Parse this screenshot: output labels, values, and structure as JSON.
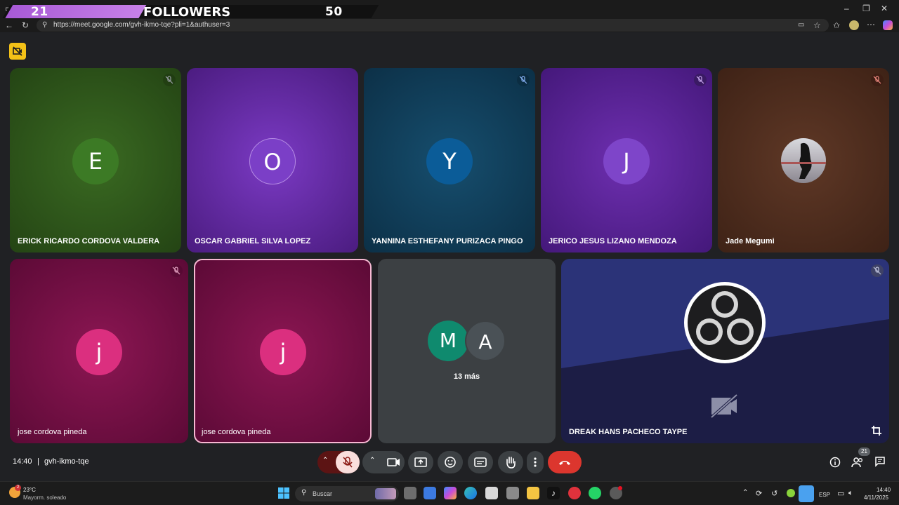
{
  "overlay": {
    "left_count": "21",
    "label": "FOLLOWERS",
    "right_count": "50"
  },
  "browser": {
    "url": "https://meet.google.com/gvh-ikmo-tqe?pli=1&authuser=3"
  },
  "participants": [
    {
      "name": "ERICK RICARDO CORDOVA VALDERA",
      "initial": "E"
    },
    {
      "name": "OSCAR GABRIEL SILVA LOPEZ",
      "initial": "O"
    },
    {
      "name": "YANNINA ESTHEFANY PURIZACA PINGO",
      "initial": "Y"
    },
    {
      "name": "JERICO JESUS LIZANO MENDOZA",
      "initial": "J"
    },
    {
      "name": "Jade Megumi",
      "initial": ""
    },
    {
      "name": "jose cordova pineda",
      "initial": "j"
    },
    {
      "name": "jose cordova pineda",
      "initial": "j"
    },
    {
      "name": "DREAK HANS PACHECO TAYPE",
      "initial": ""
    }
  ],
  "more_tile": {
    "initials": [
      "M",
      "A"
    ],
    "label": "13 más"
  },
  "meeting": {
    "time": "14:40",
    "code": "gvh-ikmo-tqe",
    "people_count": "21"
  },
  "taskbar": {
    "weather_temp": "23°C",
    "weather_desc": "Mayorm. soleado",
    "search_placeholder": "Buscar",
    "language": "ESP",
    "clock_time": "14:40",
    "clock_date": "4/11/2025"
  },
  "colors": {
    "accent_red": "#ea4335",
    "meet_bg": "#202124",
    "tile_green": "#2e5c1c",
    "tile_purple": "#5a2590",
    "tile_blue": "#103f5c",
    "tile_brown": "#4f2e20",
    "tile_magenta": "#7a0e45",
    "tile_grey": "#3c4043",
    "tile_navy": "#232a6e"
  }
}
